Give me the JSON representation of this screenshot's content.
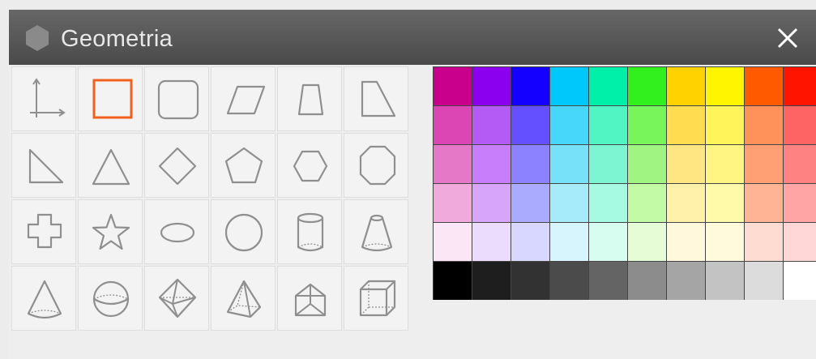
{
  "window": {
    "title": "Geometria",
    "logo_icon": "hexagon-icon",
    "close_icon": "close-icon"
  },
  "shapes": [
    {
      "name": "axes",
      "icon": "axes-icon"
    },
    {
      "name": "square",
      "icon": "square-icon",
      "selected": true
    },
    {
      "name": "rounded-rectangle",
      "icon": "rounded-rectangle-icon"
    },
    {
      "name": "parallelogram",
      "icon": "parallelogram-icon"
    },
    {
      "name": "trapezoid",
      "icon": "trapezoid-icon"
    },
    {
      "name": "right-trapezoid",
      "icon": "right-trapezoid-icon"
    },
    {
      "name": "right-triangle",
      "icon": "right-triangle-icon"
    },
    {
      "name": "triangle",
      "icon": "triangle-icon"
    },
    {
      "name": "rhombus",
      "icon": "rhombus-icon"
    },
    {
      "name": "pentagon",
      "icon": "pentagon-icon"
    },
    {
      "name": "hexagon",
      "icon": "hexagon-icon"
    },
    {
      "name": "octagon",
      "icon": "octagon-icon"
    },
    {
      "name": "cross",
      "icon": "cross-icon"
    },
    {
      "name": "star",
      "icon": "star-icon"
    },
    {
      "name": "ellipse",
      "icon": "ellipse-icon"
    },
    {
      "name": "circle",
      "icon": "circle-icon"
    },
    {
      "name": "cylinder",
      "icon": "cylinder-icon"
    },
    {
      "name": "frustum",
      "icon": "frustum-icon"
    },
    {
      "name": "cone",
      "icon": "cone-icon"
    },
    {
      "name": "sphere",
      "icon": "sphere-icon"
    },
    {
      "name": "octahedron",
      "icon": "octahedron-icon"
    },
    {
      "name": "pyramid",
      "icon": "pyramid-icon"
    },
    {
      "name": "prism",
      "icon": "prism-icon"
    },
    {
      "name": "cube",
      "icon": "cube-icon"
    }
  ],
  "colors": {
    "accent": "#f0601e",
    "icon_stroke": "#8f8f8f",
    "palette": [
      [
        "#c8008c",
        "#8c00f0",
        "#1400ff",
        "#00c8fa",
        "#00f0aa",
        "#32f01e",
        "#ffd200",
        "#fff500",
        "#ff5a00",
        "#ff1400"
      ],
      [
        "#dc46b4",
        "#b45af5",
        "#6450ff",
        "#46d7fa",
        "#50f5c3",
        "#78f55a",
        "#ffdc50",
        "#fff55a",
        "#ff915a",
        "#ff6464"
      ],
      [
        "#e678c8",
        "#c87dfa",
        "#8c82ff",
        "#78e1fa",
        "#7df5d2",
        "#a0f582",
        "#ffe682",
        "#fff582",
        "#ff9f73",
        "#ff8282"
      ],
      [
        "#f0aadc",
        "#d7a5fa",
        "#aaaaff",
        "#a5ebfa",
        "#a5fae1",
        "#c3faa5",
        "#fff0aa",
        "#fffaaa",
        "#ffb496",
        "#ffa5a5"
      ],
      [
        "#fae6f5",
        "#ebdcfd",
        "#d7d7ff",
        "#d7f5fd",
        "#d7fcf0",
        "#e6fcd7",
        "#fff8dc",
        "#fffadc",
        "#ffdcd2",
        "#ffd7d7"
      ],
      [
        "#000000",
        "#1e1e1e",
        "#323232",
        "#4b4b4b",
        "#646464",
        "#8c8c8c",
        "#a5a5a5",
        "#c3c3c3",
        "#dcdcdc",
        "#ffffff"
      ]
    ]
  }
}
